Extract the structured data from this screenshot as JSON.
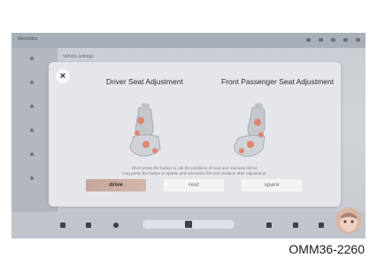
{
  "status_bar": {
    "logo": "Mercedes"
  },
  "background": {
    "header": "Vehicle settings"
  },
  "dialog": {
    "driver_title": "Driver Seat Adjustment",
    "passenger_title": "Front Passenger Seat Adjustment",
    "hint_line1": "Short press the button to call the positions of seat and rearview mirror,",
    "hint_line2": "long press the button to update and memorize the new position after adjustment.",
    "close_symbol": "×",
    "buttons": {
      "drive": "drive",
      "rest": "rest",
      "spare": "spare"
    },
    "selected_button": "drive"
  },
  "colors": {
    "accent": "#c5a79c",
    "seat": "#c4c7cc",
    "seat_highlight": "#e07a62"
  },
  "reference_code": "OMM36-2260"
}
